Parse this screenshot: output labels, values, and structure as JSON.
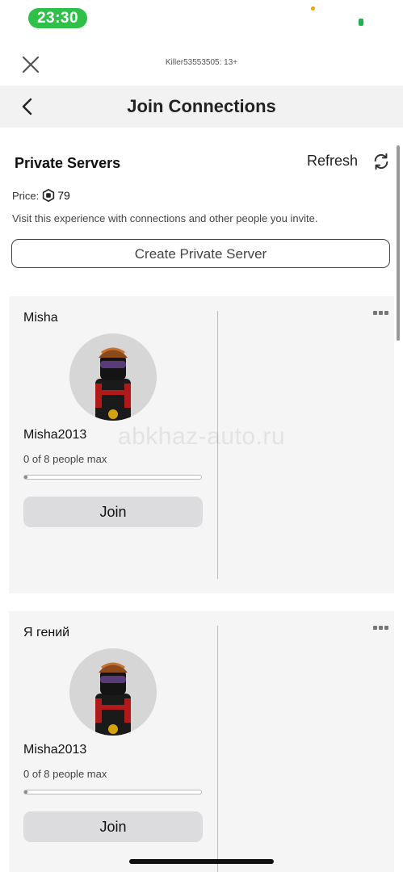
{
  "status_bar": {
    "time": "23:30"
  },
  "top_bar": {
    "account": "Killer53553505: 13+"
  },
  "header": {
    "title": "Join Connections"
  },
  "private_servers": {
    "title": "Private Servers",
    "refresh_label": "Refresh",
    "price_label": "Price:",
    "price_value": "79",
    "description": "Visit this experience with connections and other people you invite.",
    "create_button": "Create Private Server"
  },
  "servers": [
    {
      "name": "Misha",
      "owner": "Misha2013",
      "capacity": "0 of 8 people max",
      "progress": 0.02,
      "join_label": "Join"
    },
    {
      "name": "Я гений",
      "owner": "Misha2013",
      "capacity": "0 of 8 people max",
      "progress": 0.02,
      "join_label": "Join"
    }
  ],
  "watermark": "abkhaz-auto.ru",
  "colors": {
    "status_pill": "#2fc04a",
    "card_bg": "#f5f5f5",
    "join_bg": "#dcdcdf"
  }
}
